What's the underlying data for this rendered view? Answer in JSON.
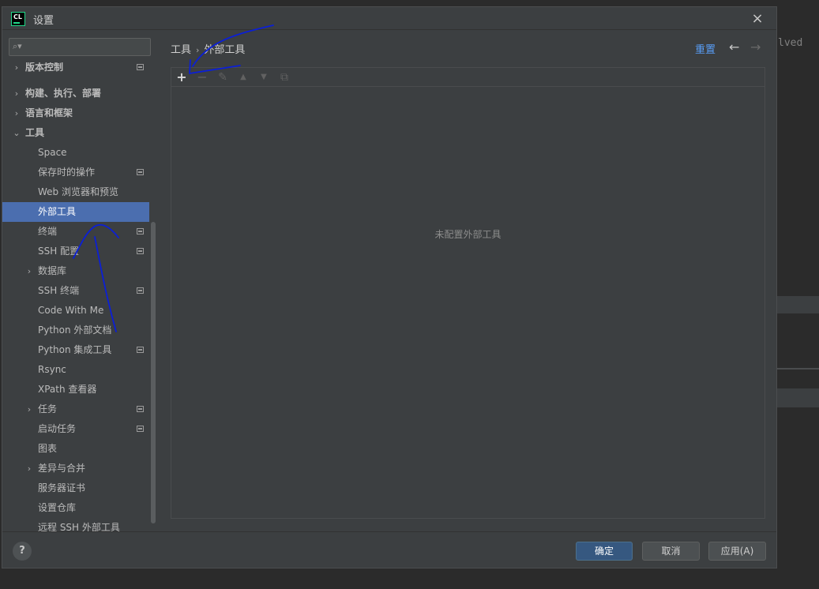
{
  "background": {
    "editor_snippet": "lved"
  },
  "dialog": {
    "app_logo": "CL",
    "title": "设置",
    "close_icon": "×"
  },
  "sidebar": {
    "search": {
      "placeholder": "",
      "value": ""
    },
    "partial_item": "版本控制",
    "items": [
      {
        "label": "构建、执行、部署",
        "level": 0,
        "expander": "›",
        "project_icon": false
      },
      {
        "label": "语言和框架",
        "level": 0,
        "expander": "›",
        "project_icon": false
      },
      {
        "label": "工具",
        "level": 0,
        "expander": "⌄",
        "project_icon": false
      },
      {
        "label": "Space",
        "level": 1,
        "expander": "",
        "project_icon": false
      },
      {
        "label": "保存时的操作",
        "level": 1,
        "expander": "",
        "project_icon": true
      },
      {
        "label": "Web 浏览器和预览",
        "level": 1,
        "expander": "",
        "project_icon": false
      },
      {
        "label": "外部工具",
        "level": 1,
        "expander": "",
        "project_icon": false,
        "selected": true
      },
      {
        "label": "终端",
        "level": 1,
        "expander": "",
        "project_icon": true
      },
      {
        "label": "SSH 配置",
        "level": 1,
        "expander": "",
        "project_icon": true
      },
      {
        "label": "数据库",
        "level": 1,
        "expander": "›",
        "project_icon": false
      },
      {
        "label": "SSH 终端",
        "level": 1,
        "expander": "",
        "project_icon": true
      },
      {
        "label": "Code With Me",
        "level": 1,
        "expander": "",
        "project_icon": false
      },
      {
        "label": "Python 外部文档",
        "level": 1,
        "expander": "",
        "project_icon": false
      },
      {
        "label": "Python 集成工具",
        "level": 1,
        "expander": "",
        "project_icon": true
      },
      {
        "label": "Rsync",
        "level": 1,
        "expander": "",
        "project_icon": false
      },
      {
        "label": "XPath 查看器",
        "level": 1,
        "expander": "",
        "project_icon": false
      },
      {
        "label": "任务",
        "level": 1,
        "expander": "›",
        "project_icon": true
      },
      {
        "label": "启动任务",
        "level": 1,
        "expander": "",
        "project_icon": true
      },
      {
        "label": "图表",
        "level": 1,
        "expander": "",
        "project_icon": false
      },
      {
        "label": "差异与合并",
        "level": 1,
        "expander": "›",
        "project_icon": false
      },
      {
        "label": "服务器证书",
        "level": 1,
        "expander": "",
        "project_icon": false
      },
      {
        "label": "设置仓库",
        "level": 1,
        "expander": "",
        "project_icon": false
      },
      {
        "label": "远程 SSH 外部工具",
        "level": 1,
        "expander": "",
        "project_icon": false
      }
    ]
  },
  "main": {
    "breadcrumb": [
      "工具",
      "外部工具"
    ],
    "breadcrumb_sep": "›",
    "reset_label": "重置",
    "back_icon": "←",
    "forward_icon": "→",
    "toolbar": {
      "add_icon": "+",
      "remove_icon": "−",
      "edit_icon": "✎",
      "move_up_icon": "▲",
      "move_down_icon": "▼",
      "copy_icon": "⧉"
    },
    "empty_text": "未配置外部工具"
  },
  "footer": {
    "help_label": "?",
    "ok_label": "确定",
    "cancel_label": "取消",
    "apply_label": "应用(A)"
  },
  "colors": {
    "accent": "#4b6eaf",
    "link": "#589df6",
    "primary_button": "#365880",
    "annotation_ink": "#0b1fd6"
  }
}
